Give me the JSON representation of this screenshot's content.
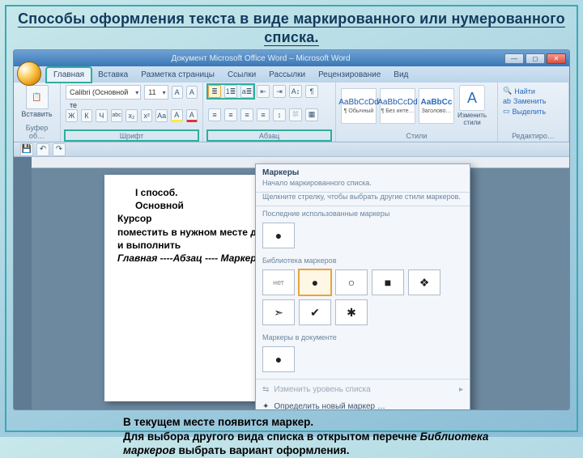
{
  "slide": {
    "title": "Способы оформления текста в виде  маркированного или нумерованного списка."
  },
  "window": {
    "title": "Документ Microsoft Office Word – Microsoft Word",
    "min": "—",
    "max": "◻",
    "close": "✕"
  },
  "tabs": {
    "t0": "Главная",
    "t1": "Вставка",
    "t2": "Разметка страницы",
    "t3": "Ссылки",
    "t4": "Рассылки",
    "t5": "Рецензирование",
    "t6": "Вид"
  },
  "groups": {
    "clip": "Буфер об…",
    "font": "Шрифт",
    "para": "Абзац",
    "styles": "Стили",
    "edit": "Редактиро…"
  },
  "font": {
    "name": "Calibri (Основной те",
    "size": "11",
    "B": "Ж",
    "I": "К",
    "U": "Ч",
    "strike": "abc",
    "sub": "x₂",
    "sup": "x²",
    "Aa": "Aa",
    "Aplus": "A",
    "Aminus": "A",
    "clear": "Aᵃ",
    "hcolor": "A",
    "fcolor": "A"
  },
  "para": {
    "bul": "≣",
    "num": "1≣",
    "multi": "a≣",
    "decInd": "⇤",
    "incInd": "⇥",
    "sort": "А↕",
    "pilcrow": "¶",
    "al": "≡",
    "ac": "≡",
    "ar": "≡",
    "aj": "≡",
    "lh": "↕",
    "bord": "▦",
    "fill": "⛆"
  },
  "styleTiles": {
    "preview": "AaBbCcDd",
    "s0": "¶ Обычный",
    "s1": "¶ Без инте…",
    "s2": "Заголово…",
    "bigA": "A",
    "change1": "Изменить",
    "change2": "стили"
  },
  "editing": {
    "find": "Найти",
    "replace": "Заменить",
    "select": "Выделить"
  },
  "paste": {
    "label": "Вставить"
  },
  "doc": {
    "l1": "I  способ.",
    "l2": "Основной",
    "l3": "Курсор",
    "l4": "поместить в нужном месте документа и выполнить",
    "l5": "Главная ----Абзац  ---- Маркеры"
  },
  "popup": {
    "title": "Маркеры",
    "sub1": "Начало маркированного списка.",
    "sub2": "Щелкните стрелку, чтобы выбрать другие стили маркеров.",
    "sec1": "Последние использованные маркеры",
    "sec2": "Библиотека маркеров",
    "sec3": "Маркеры в документе",
    "none": "нет",
    "lvl": "Изменить уровень списка",
    "def": "Определить новый маркер …",
    "b_disc": "●",
    "b_circ": "○",
    "b_sq": "■",
    "b_diam": "❖",
    "b_arrow": "➣",
    "b_check": "✔",
    "b_star": "✱"
  },
  "bottom": {
    "l1": "В текущем месте появится маркер.",
    "l2a": "Для выбора другого вида списка  в открытом перечне ",
    "l2b": "Библиотека маркеров",
    "l2c": " выбрать вариант оформления."
  }
}
